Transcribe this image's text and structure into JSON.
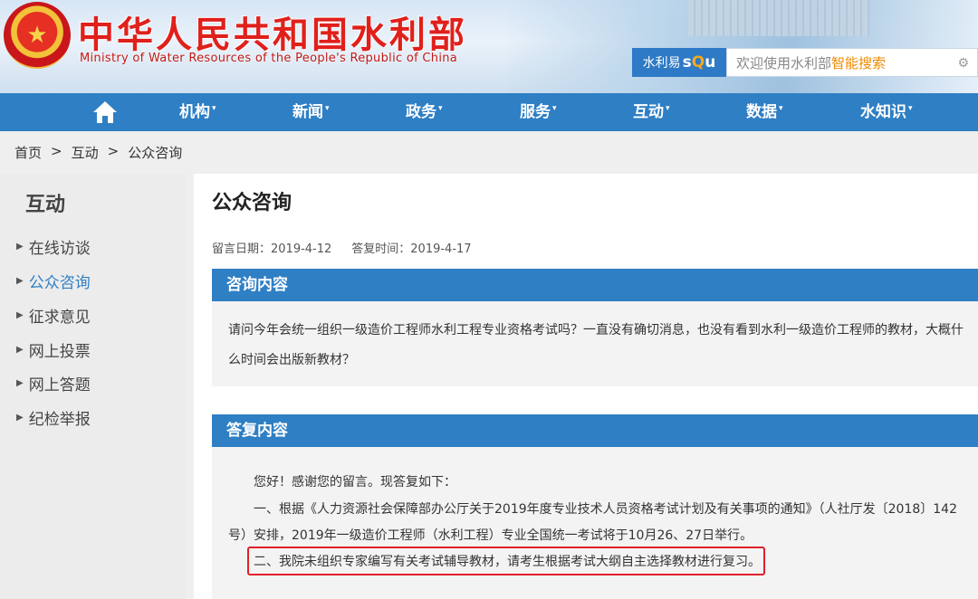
{
  "header": {
    "title": "中华人民共和国水利部",
    "subtitle": "Ministry of Water Resources of the People's Republic of China",
    "emblem_icon": "national-emblem-icon",
    "search": {
      "brand_prefix": "水利易",
      "brand_logo": "squ",
      "placeholder_prefix": "欢迎使用水利部",
      "placeholder_highlight": "智能搜索",
      "settings_icon": "gear-icon"
    }
  },
  "nav": {
    "home_icon": "home-icon",
    "items": [
      {
        "label": "机构"
      },
      {
        "label": "新闻"
      },
      {
        "label": "政务"
      },
      {
        "label": "服务"
      },
      {
        "label": "互动"
      },
      {
        "label": "数据"
      },
      {
        "label": "水知识"
      }
    ],
    "caret": "▾"
  },
  "breadcrumb": {
    "items": [
      "首页",
      "互动",
      "公众咨询"
    ],
    "separator": ">"
  },
  "sidebar": {
    "title": "互动",
    "items": [
      {
        "label": "在线访谈"
      },
      {
        "label": "公众咨询",
        "active": true
      },
      {
        "label": "征求意见"
      },
      {
        "label": "网上投票"
      },
      {
        "label": "网上答题"
      },
      {
        "label": "纪检举报"
      }
    ]
  },
  "main": {
    "title": "公众咨询",
    "message_date": "留言日期：2019-4-12",
    "reply_date": "答复时间：2019-4-17",
    "question": {
      "heading": "咨询内容",
      "text": "请问今年会统一组织一级造价工程师水利工程专业资格考试吗？一直没有确切消息，也没有看到水利一级造价工程师的教材，大概什么时间会出版新教材？"
    },
    "answer": {
      "heading": "答复内容",
      "greeting": "您好！感谢您的留言。现答复如下：",
      "para1_line1": "一、根据《人力资源社会保障部办公厅关于2019年度专业技术人员资格考试计划及有关事项的通知》（人社厅发〔2018〕142",
      "para1_line2": "号）安排，2019年一级造价工程师（水利工程）专业全国统一考试将于10月26、27日举行。",
      "para2": "二、我院未组织专家编写有关考试辅导教材，请考生根据考试大纲自主选择教材进行复习。"
    }
  },
  "colors": {
    "nav_blue": "#2f7fc4",
    "title_red": "#e0201b",
    "highlight_border": "#e0202a",
    "search_accent": "#f08a00"
  }
}
